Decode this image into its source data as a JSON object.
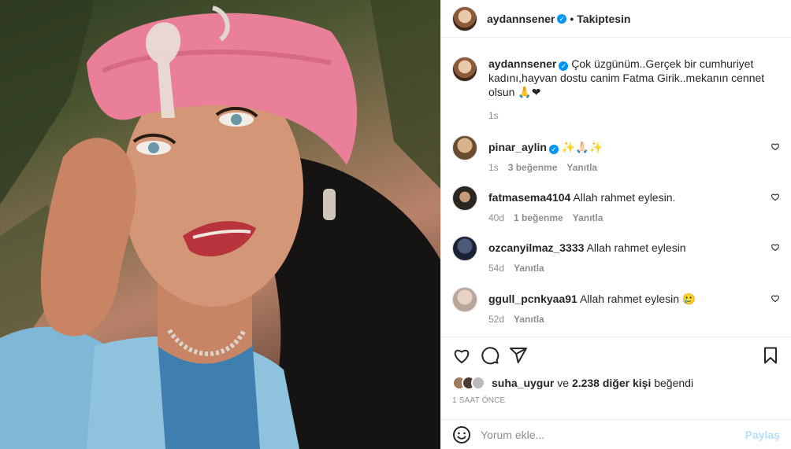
{
  "post": {
    "image_alt": "Portrait of a woman in a pink turban with jeweled ornament"
  },
  "header": {
    "username": "aydannsener",
    "verified_glyph": "✓",
    "separator": "•",
    "follow_label": "Takiptesin"
  },
  "caption": {
    "username": "aydannsener",
    "text": "Çok üzgünüm..Gerçek bir cumhuriyet kadını,hayvan dostu canim Fatma Girik..mekanın cennet olsun 🙏❤",
    "time": "1s"
  },
  "comments": [
    {
      "username": "pinar_aylin",
      "verified": true,
      "text": "✨🙏🏻✨",
      "time": "1s",
      "likes": "3 beğenme",
      "reply": "Yanıtla"
    },
    {
      "username": "fatmasema4104",
      "verified": false,
      "text": "Allah rahmet eylesin.",
      "time": "40d",
      "likes": "1 beğenme",
      "reply": "Yanıtla"
    },
    {
      "username": "ozcanyilmaz_3333",
      "verified": false,
      "text": "Allah rahmet eylesin",
      "time": "54d",
      "likes": "",
      "reply": "Yanıtla"
    },
    {
      "username": "ggull_pcnkyaa91",
      "verified": false,
      "text": "Allah rahmet eylesin 🥲",
      "time": "52d",
      "likes": "",
      "reply": "Yanıtla"
    }
  ],
  "likes": {
    "first_liker": "suha_uygur",
    "connector": "ve",
    "others": "2.238 diğer kişi",
    "suffix": "beğendi"
  },
  "timestamp": "1 SAAT ÖNCE",
  "add_comment": {
    "placeholder": "Yorum ekle...",
    "post_label": "Paylaş"
  },
  "icons": [
    "heart-icon",
    "comment-icon",
    "share-icon",
    "bookmark-icon",
    "emoji-icon"
  ],
  "colors": {
    "link": "#0095f6",
    "muted": "#8e8e8e",
    "text": "#262626",
    "post_disabled": "#b2dffc"
  }
}
